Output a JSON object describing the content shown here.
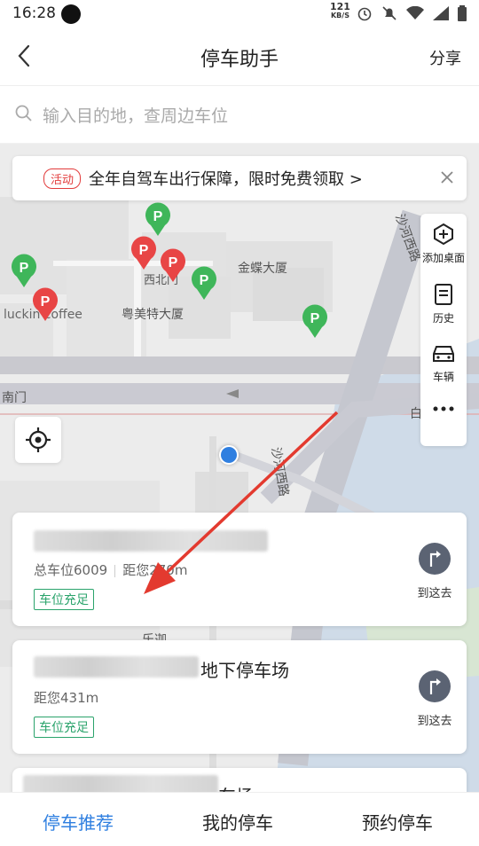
{
  "status": {
    "time": "16:28",
    "net_speed": "121",
    "net_unit": "KB/S"
  },
  "header": {
    "title": "停车助手",
    "share_label": "分享"
  },
  "search": {
    "placeholder": "输入目的地，查周边车位"
  },
  "banner": {
    "badge": "活动",
    "text": "全年自驾车出行保障，限时免费领取 >"
  },
  "map": {
    "labels": {
      "xibei": "西北门",
      "jindie": "金蝶大厦",
      "luckin": "luckin coffee",
      "yuemeite": "粤美特大厦",
      "nanmen": "南门",
      "shahexilu1": "沙河西路",
      "shahexilu2": "沙河西路",
      "lejia": "乐迦",
      "bai": "白"
    }
  },
  "tools": [
    {
      "label": "添加桌面",
      "icon": "add-desktop-icon"
    },
    {
      "label": "历史",
      "icon": "history-icon"
    },
    {
      "label": "车辆",
      "icon": "car-icon"
    },
    {
      "label": "",
      "icon": "more-icon"
    }
  ],
  "cards": [
    {
      "name": "",
      "spaces": "总车位6009",
      "distance": "距您270m",
      "tag": "车位充足",
      "go_label": "到这去"
    },
    {
      "name": "地下停车场",
      "distance": "距您431m",
      "tag": "车位充足",
      "go_label": "到这去"
    },
    {
      "name": "车场"
    }
  ],
  "tabs": [
    {
      "label": "停车推荐",
      "active": true
    },
    {
      "label": "我的停车",
      "active": false
    },
    {
      "label": "预约停车",
      "active": false
    }
  ],
  "colors": {
    "accent": "#2f7fe0",
    "green_tag": "#2aa36b",
    "red_badge": "#e23b3b",
    "parking_green": "#3fb65a",
    "parking_red": "#e84545"
  }
}
